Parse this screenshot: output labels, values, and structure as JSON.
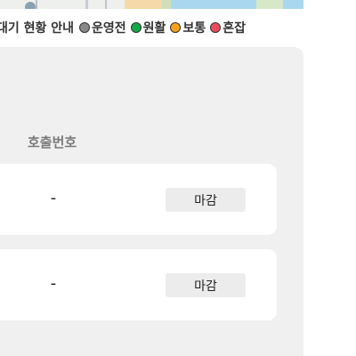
{
  "legend": {
    "title": "대기 현황 안내",
    "items": [
      {
        "label": "운영전",
        "color": "#888888"
      },
      {
        "label": "원활",
        "color": "#13a84b"
      },
      {
        "label": "보통",
        "color": "#f7a21a"
      },
      {
        "label": "혼잡",
        "color": "#e94c5e"
      }
    ]
  },
  "table": {
    "header_call_number": "호출번호",
    "rows": [
      {
        "call_number": "-",
        "status": "마감"
      },
      {
        "call_number": "-",
        "status": "마감"
      }
    ]
  }
}
